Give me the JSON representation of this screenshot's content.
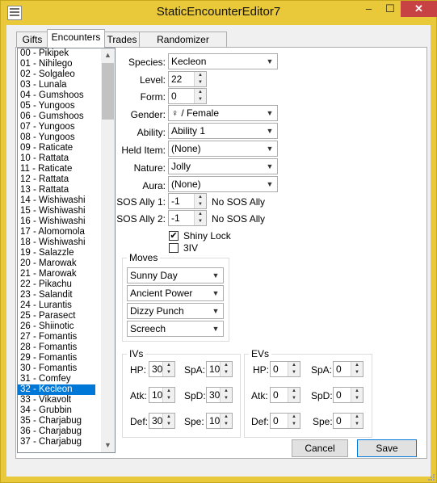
{
  "window": {
    "title": "StaticEncounterEditor7",
    "minimize": "–",
    "maximize": "☐",
    "close": "✕"
  },
  "tabs": [
    "Gifts",
    "Encounters",
    "Trades",
    "Randomizer Options"
  ],
  "encounters": [
    "00 - Pikipek",
    "01 - Nihilego",
    "02 - Solgaleo",
    "03 - Lunala",
    "04 - Gumshoos",
    "05 - Yungoos",
    "06 - Gumshoos",
    "07 - Yungoos",
    "08 - Yungoos",
    "09 - Raticate",
    "10 - Rattata",
    "11 - Raticate",
    "12 - Rattata",
    "13 - Rattata",
    "14 - Wishiwashi",
    "15 - Wishiwashi",
    "16 - Wishiwashi",
    "17 - Alomomola",
    "18 - Wishiwashi",
    "19 - Salazzle",
    "20 - Marowak",
    "21 - Marowak",
    "22 - Pikachu",
    "23 - Salandit",
    "24 - Lurantis",
    "25 - Parasect",
    "26 - Shiinotic",
    "27 - Fomantis",
    "28 - Fomantis",
    "29 - Fomantis",
    "30 - Fomantis",
    "31 - Comfey",
    "32 - Kecleon",
    "33 - Vikavolt",
    "34 - Grubbin",
    "35 - Charjabug",
    "36 - Charjabug",
    "37 - Charjabug"
  ],
  "selected_index": 32,
  "labels": {
    "species": "Species:",
    "level": "Level:",
    "form": "Form:",
    "gender": "Gender:",
    "ability": "Ability:",
    "held_item": "Held Item:",
    "nature": "Nature:",
    "aura": "Aura:",
    "sos1": "SOS Ally 1:",
    "sos2": "SOS Ally 2:"
  },
  "fields": {
    "species": "Kecleon",
    "level": "22",
    "form": "0",
    "gender": "♀ / Female",
    "ability": "Ability 1",
    "held_item": "(None)",
    "nature": "Jolly",
    "aura": "(None)",
    "sos1": "-1",
    "sos2": "-1",
    "sos1_note": "No SOS Ally",
    "sos2_note": "No SOS Ally"
  },
  "checks": {
    "shiny_lock": {
      "label": "Shiny Lock",
      "checked": true
    },
    "three_iv": {
      "label": "3IV",
      "checked": false
    }
  },
  "moves": {
    "title": "Moves",
    "list": [
      "Sunny Day",
      "Ancient Power",
      "Dizzy Punch",
      "Screech"
    ]
  },
  "ivs": {
    "title": "IVs",
    "hp_label": "HP:",
    "atk_label": "Atk:",
    "def_label": "Def:",
    "spa_label": "SpA:",
    "spd_label": "SpD:",
    "spe_label": "Spe:",
    "hp": "30",
    "atk": "10",
    "def": "30",
    "spa": "10",
    "spd": "30",
    "spe": "10"
  },
  "evs": {
    "title": "EVs",
    "hp_label": "HP:",
    "atk_label": "Atk:",
    "def_label": "Def:",
    "spa_label": "SpA:",
    "spd_label": "SpD:",
    "spe_label": "Spe:",
    "hp": "0",
    "atk": "0",
    "def": "0",
    "spa": "0",
    "spd": "0",
    "spe": "0"
  },
  "buttons": {
    "cancel": "Cancel",
    "save": "Save"
  },
  "colors": {
    "titlebar": "#e9c93a",
    "selection": "#0078d7",
    "close": "#c74343"
  }
}
